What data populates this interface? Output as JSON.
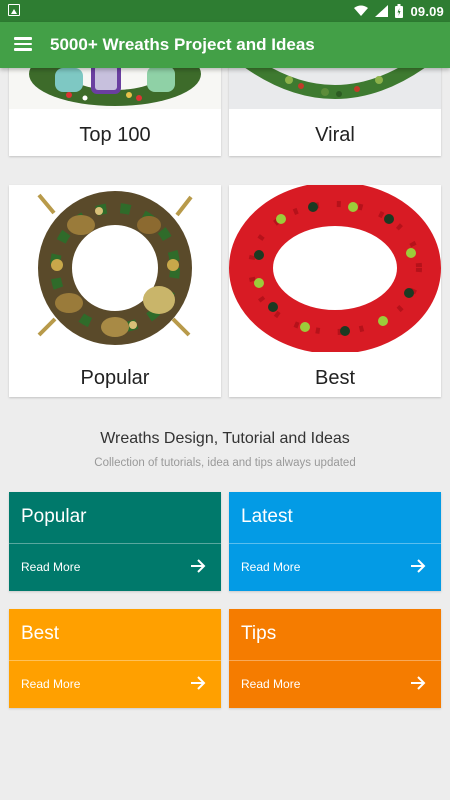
{
  "statusbar": {
    "time": "09.09"
  },
  "appbar": {
    "title": "5000+ Wreaths Project and Ideas"
  },
  "categories": [
    {
      "label": "Top 100"
    },
    {
      "label": "Viral"
    },
    {
      "label": "Popular"
    },
    {
      "label": "Best"
    }
  ],
  "section": {
    "title": "Wreaths Design, Tutorial and Ideas",
    "subtitle": "Collection of tutorials, idea and tips always updated"
  },
  "tiles": [
    {
      "title": "Popular",
      "action": "Read More",
      "color": "#00796b"
    },
    {
      "title": "Latest",
      "action": "Read More",
      "color": "#039be5"
    },
    {
      "title": "Best",
      "action": "Read More",
      "color": "#ffa000"
    },
    {
      "title": "Tips",
      "action": "Read More",
      "color": "#f57c00"
    }
  ],
  "icons": [
    "image-icon",
    "wifi-icon",
    "signal-icon",
    "battery-icon",
    "menu-icon",
    "arrow-right-icon"
  ]
}
